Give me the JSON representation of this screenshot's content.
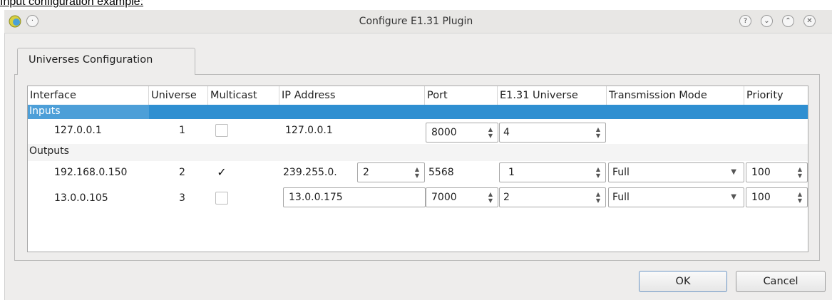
{
  "caption": "Input configuration example:",
  "window": {
    "title": "Configure E1.31 Plugin",
    "icons": {
      "app": "qlc-logo-icon",
      "pin": "circle-menu-icon",
      "help": "help-icon",
      "minimize": "minimize-icon",
      "maximize": "maximize-icon",
      "close": "close-icon"
    },
    "help_glyph": "?",
    "min_glyph": "⌄",
    "max_glyph": "⌃",
    "close_glyph": "✕",
    "pin_glyph": "·"
  },
  "tab": {
    "label": "Universes Configuration"
  },
  "columns": [
    "Interface",
    "Universe",
    "Multicast",
    "IP Address",
    "Port",
    "E1.31 Universe",
    "Transmission Mode",
    "Priority"
  ],
  "groups": {
    "inputs": "Inputs",
    "outputs": "Outputs"
  },
  "inputs": [
    {
      "interface": "127.0.0.1",
      "universe": "1",
      "multicast": false,
      "ip": "127.0.0.1",
      "port": "8000",
      "e131_universe": "4"
    }
  ],
  "outputs": [
    {
      "interface": "192.168.0.150",
      "universe": "2",
      "multicast": true,
      "ip_prefix": "239.255.0.",
      "ip_spin": "2",
      "port": "5568",
      "e131_universe": "1",
      "mode": "Full",
      "priority": "100"
    },
    {
      "interface": "13.0.0.105",
      "universe": "3",
      "multicast": false,
      "ip": "13.0.0.175",
      "port": "7000",
      "e131_universe": "2",
      "mode": "Full",
      "priority": "100"
    }
  ],
  "check_glyph": "✓",
  "buttons": {
    "ok": "OK",
    "cancel": "Cancel"
  },
  "colors": {
    "selection": "#2f8fd1",
    "window_bg": "#eeedec"
  }
}
